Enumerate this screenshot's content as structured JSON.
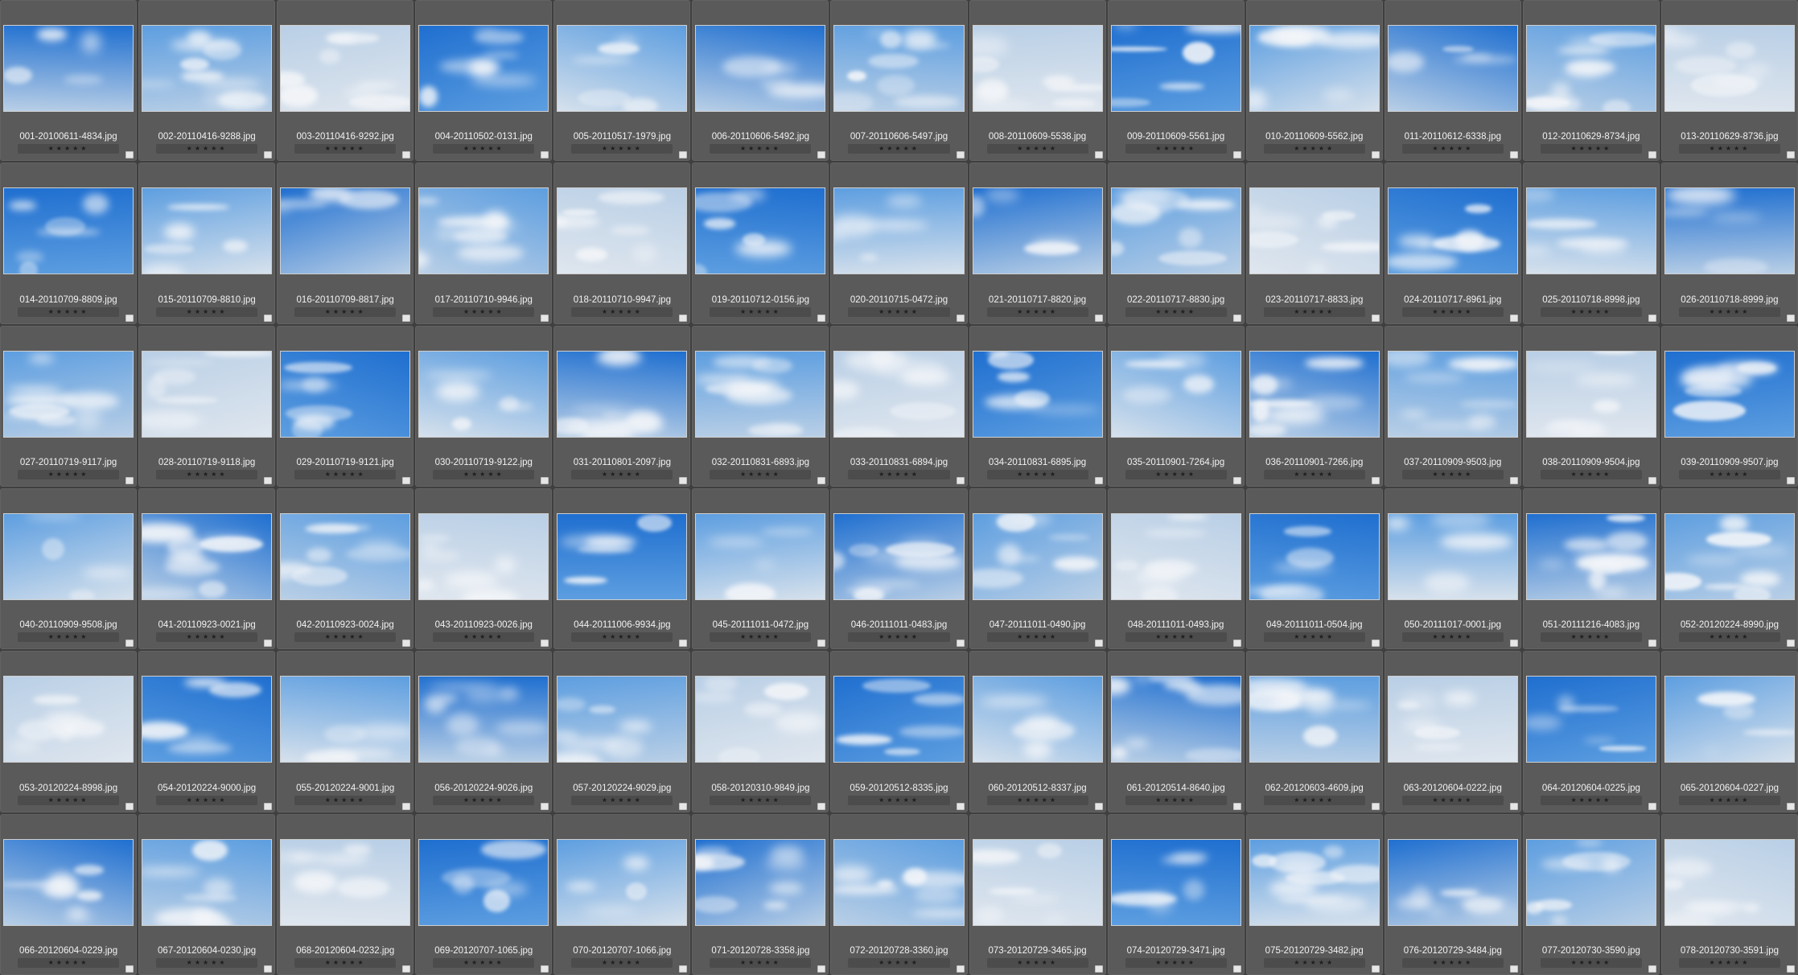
{
  "browser": {
    "rating_glyph": "★★★★★",
    "thumbnails": [
      {
        "filename": "001-20100611-4834.jpg"
      },
      {
        "filename": "002-20110416-9288.jpg"
      },
      {
        "filename": "003-20110416-9292.jpg"
      },
      {
        "filename": "004-20110502-0131.jpg"
      },
      {
        "filename": "005-20110517-1979.jpg"
      },
      {
        "filename": "006-20110606-5492.jpg"
      },
      {
        "filename": "007-20110606-5497.jpg"
      },
      {
        "filename": "008-20110609-5538.jpg"
      },
      {
        "filename": "009-20110609-5561.jpg"
      },
      {
        "filename": "010-20110609-5562.jpg"
      },
      {
        "filename": "011-20110612-6338.jpg"
      },
      {
        "filename": "012-20110629-8734.jpg"
      },
      {
        "filename": "013-20110629-8736.jpg"
      },
      {
        "filename": "014-20110709-8809.jpg"
      },
      {
        "filename": "015-20110709-8810.jpg"
      },
      {
        "filename": "016-20110709-8817.jpg"
      },
      {
        "filename": "017-20110710-9946.jpg"
      },
      {
        "filename": "018-20110710-9947.jpg"
      },
      {
        "filename": "019-20110712-0156.jpg"
      },
      {
        "filename": "020-20110715-0472.jpg"
      },
      {
        "filename": "021-20110717-8820.jpg"
      },
      {
        "filename": "022-20110717-8830.jpg"
      },
      {
        "filename": "023-20110717-8833.jpg"
      },
      {
        "filename": "024-20110717-8961.jpg"
      },
      {
        "filename": "025-20110718-8998.jpg"
      },
      {
        "filename": "026-20110718-8999.jpg"
      },
      {
        "filename": "027-20110719-9117.jpg"
      },
      {
        "filename": "028-20110719-9118.jpg"
      },
      {
        "filename": "029-20110719-9121.jpg"
      },
      {
        "filename": "030-20110719-9122.jpg"
      },
      {
        "filename": "031-20110801-2097.jpg"
      },
      {
        "filename": "032-20110831-6893.jpg"
      },
      {
        "filename": "033-20110831-6894.jpg"
      },
      {
        "filename": "034-20110831-6895.jpg"
      },
      {
        "filename": "035-20110901-7264.jpg"
      },
      {
        "filename": "036-20110901-7266.jpg"
      },
      {
        "filename": "037-20110909-9503.jpg"
      },
      {
        "filename": "038-20110909-9504.jpg"
      },
      {
        "filename": "039-20110909-9507.jpg"
      },
      {
        "filename": "040-20110909-9508.jpg"
      },
      {
        "filename": "041-20110923-0021.jpg"
      },
      {
        "filename": "042-20110923-0024.jpg"
      },
      {
        "filename": "043-20110923-0026.jpg"
      },
      {
        "filename": "044-20111006-9934.jpg"
      },
      {
        "filename": "045-20111011-0472.jpg"
      },
      {
        "filename": "046-20111011-0483.jpg"
      },
      {
        "filename": "047-20111011-0490.jpg"
      },
      {
        "filename": "048-20111011-0493.jpg"
      },
      {
        "filename": "049-20111011-0504.jpg"
      },
      {
        "filename": "050-20111017-0001.jpg"
      },
      {
        "filename": "051-20111216-4083.jpg"
      },
      {
        "filename": "052-20120224-8990.jpg"
      },
      {
        "filename": "053-20120224-8998.jpg"
      },
      {
        "filename": "054-20120224-9000.jpg"
      },
      {
        "filename": "055-20120224-9001.jpg"
      },
      {
        "filename": "056-20120224-9026.jpg"
      },
      {
        "filename": "057-20120224-9029.jpg"
      },
      {
        "filename": "058-20120310-9849.jpg"
      },
      {
        "filename": "059-20120512-8335.jpg"
      },
      {
        "filename": "060-20120512-8337.jpg"
      },
      {
        "filename": "061-20120514-8640.jpg"
      },
      {
        "filename": "062-20120603-4609.jpg"
      },
      {
        "filename": "063-20120604-0222.jpg"
      },
      {
        "filename": "064-20120604-0225.jpg"
      },
      {
        "filename": "065-20120604-0227.jpg"
      },
      {
        "filename": "066-20120604-0229.jpg"
      },
      {
        "filename": "067-20120604-0230.jpg"
      },
      {
        "filename": "068-20120604-0232.jpg"
      },
      {
        "filename": "069-20120707-1065.jpg"
      },
      {
        "filename": "070-20120707-1066.jpg"
      },
      {
        "filename": "071-20120728-3358.jpg"
      },
      {
        "filename": "072-20120728-3360.jpg"
      },
      {
        "filename": "073-20120729-3465.jpg"
      },
      {
        "filename": "074-20120729-3471.jpg"
      },
      {
        "filename": "075-20120729-3482.jpg"
      },
      {
        "filename": "076-20120729-3484.jpg"
      },
      {
        "filename": "077-20120730-3590.jpg"
      },
      {
        "filename": "078-20120730-3591.jpg"
      }
    ]
  },
  "colors": {
    "panel_background": "#4a4a4a",
    "cell_background": "#5a5a5a",
    "filename_text": "#f2f2f2",
    "rating_stars": "#1e1e1e",
    "sky_deep": "#1f6fd0",
    "sky_mid": "#5d9ee0",
    "sky_pale": "#b9cfe6",
    "cloud_white": "#f4f6f9"
  }
}
